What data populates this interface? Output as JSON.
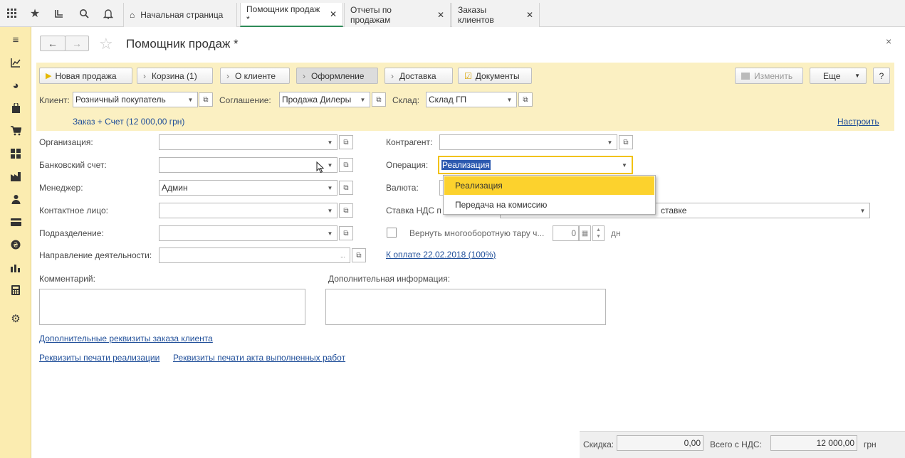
{
  "topbar": {
    "icons": [
      "apps-grid-icon",
      "star-icon",
      "history-icon",
      "search-icon",
      "bell-icon"
    ],
    "tabs": [
      {
        "label": "Начальная страница",
        "closable": false
      },
      {
        "label": "Помощник продаж *",
        "closable": true,
        "active": true
      },
      {
        "label": "Отчеты по продажам",
        "closable": true
      },
      {
        "label": "Заказы клиентов",
        "closable": true
      }
    ]
  },
  "sidebar": {
    "icons": [
      "menu-icon",
      "chart-line-icon",
      "pie-chart-icon",
      "shopping-bag-icon",
      "cart-icon",
      "grid-icon",
      "factory-icon",
      "person-icon",
      "card-icon",
      "money-icon",
      "bar-chart-icon",
      "calculator-icon",
      "gear-icon"
    ]
  },
  "title": {
    "text": "Помощник продаж *",
    "back": "←",
    "forward": "→",
    "close": "×"
  },
  "commands": {
    "new_sale": "Новая продажа",
    "cart": "Корзина (1)",
    "about_client": "О клиенте",
    "checkout": "Оформление",
    "delivery": "Доставка",
    "documents": "Документы",
    "change": "Изменить",
    "more": "Еще",
    "help": "?"
  },
  "header_fields": {
    "client_label": "Клиент:",
    "client_value": "Розничный покупатель",
    "agreement_label": "Соглашение:",
    "agreement_value": "Продажа Дилеры",
    "warehouse_label": "Склад:",
    "warehouse_value": "Склад ГП",
    "order_summary": "Заказ + Счет (12 000,00 грн)",
    "configure": "Настроить"
  },
  "form": {
    "organization_label": "Организация:",
    "organization_value": "",
    "bank_account_label": "Банковский счет:",
    "bank_account_value": "",
    "manager_label": "Менеджер:",
    "manager_value": "Админ",
    "contact_label": "Контактное лицо:",
    "contact_value": "",
    "department_label": "Подразделение:",
    "department_value": "",
    "activity_label": "Направление деятельности:",
    "activity_value": "",
    "activity_dots": "...",
    "counterparty_label": "Контрагент:",
    "counterparty_value": "",
    "operation_label": "Операция:",
    "operation_value": "Реализация",
    "currency_label": "Валюта:",
    "vat_label": "Ставка НДС п",
    "vat_value_tail": "ставке",
    "return_label": "Вернуть многооборотную тару ч...",
    "return_days_value": "0",
    "return_days_unit": "дн",
    "payment_link": "К оплате 22.02.2018 (100%)",
    "comment_label": "Комментарий:",
    "extra_info_label": "Дополнительная информация:"
  },
  "links": {
    "extra_props": "Дополнительные реквизиты заказа клиента",
    "print_sale": "Реквизиты печати реализации",
    "print_act": "Реквизиты печати акта выполненных работ"
  },
  "popup": {
    "items": [
      "Реализация",
      "Передача на комиссию"
    ],
    "selected_index": 0
  },
  "footer": {
    "discount_label": "Скидка:",
    "discount_value": "0,00",
    "total_label": "Всего с НДС:",
    "total_value": "12 000,00",
    "currency": "грн"
  },
  "colors": {
    "sidebar_bg": "#fbecb0",
    "command_area_bg": "#fbf0c2",
    "popup_selected": "#fcd22d",
    "link": "#1f4e99",
    "active_tab_underline": "#2e8b57"
  }
}
